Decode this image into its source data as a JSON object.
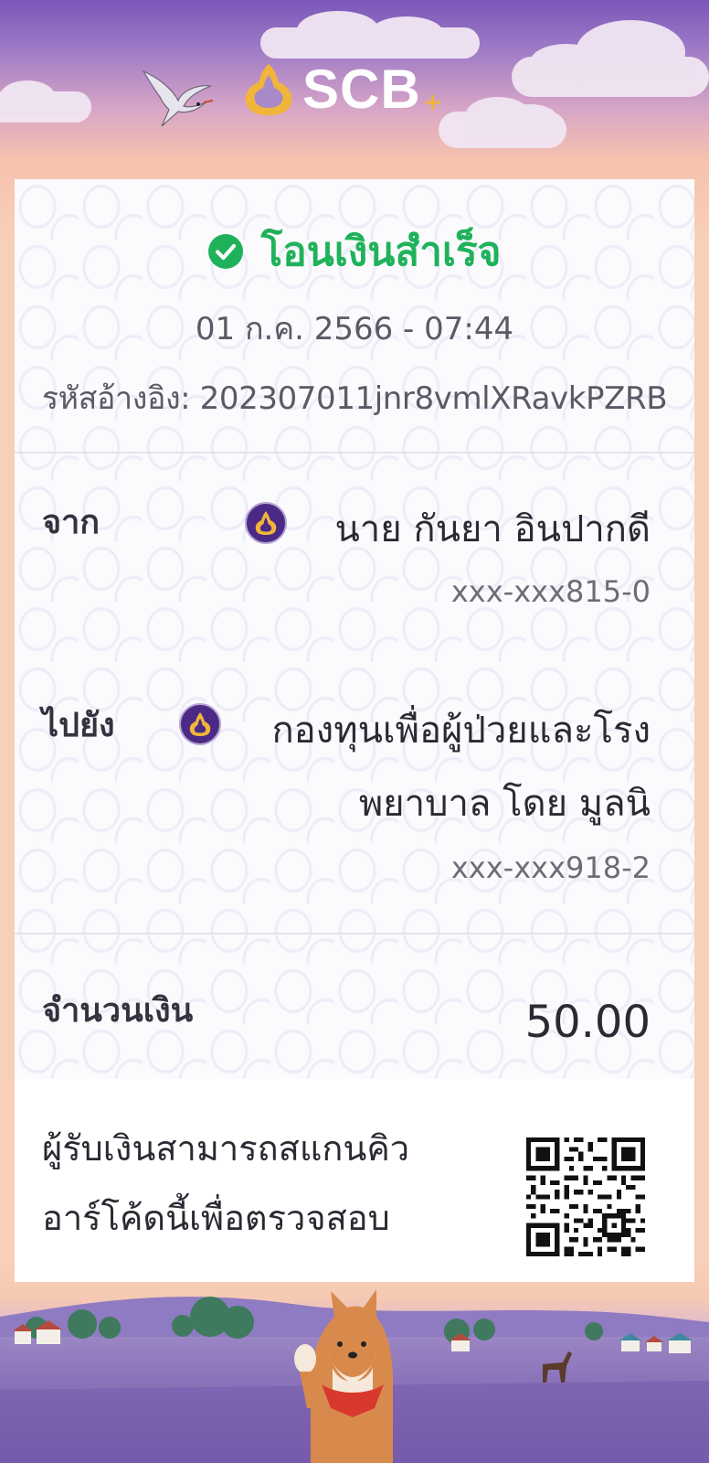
{
  "header": {
    "brand": "SCB",
    "brand_plus": "+"
  },
  "status": {
    "title": "โอนเงินสำเร็จ"
  },
  "transaction": {
    "datetime": "01 ก.ค. 2566 - 07:44",
    "reference": "รหัสอ้างอิง: 202307011jnr8vmlXRavkPZRB"
  },
  "from": {
    "label": "จาก",
    "name": "นาย กันยา อินปากดี",
    "account": "xxx-xxx815-0"
  },
  "to": {
    "label": "ไปยัง",
    "name_line1": "กองทุนเพื่อผู้ป่วยและโรง",
    "name_line2": "พยาบาล โดย มูลนิ",
    "account": "xxx-xxx918-2"
  },
  "amount": {
    "label": "จำนวนเงิน",
    "value": "50.00"
  },
  "qr": {
    "line1": "ผู้รับเงินสามารถสแกนคิว",
    "line2": "อาร์โค้ดนี้เพื่อตรวจสอบ"
  },
  "colors": {
    "success": "#1fb25a",
    "brand_purple": "#4b2a85",
    "brand_gold": "#f0b53a"
  }
}
